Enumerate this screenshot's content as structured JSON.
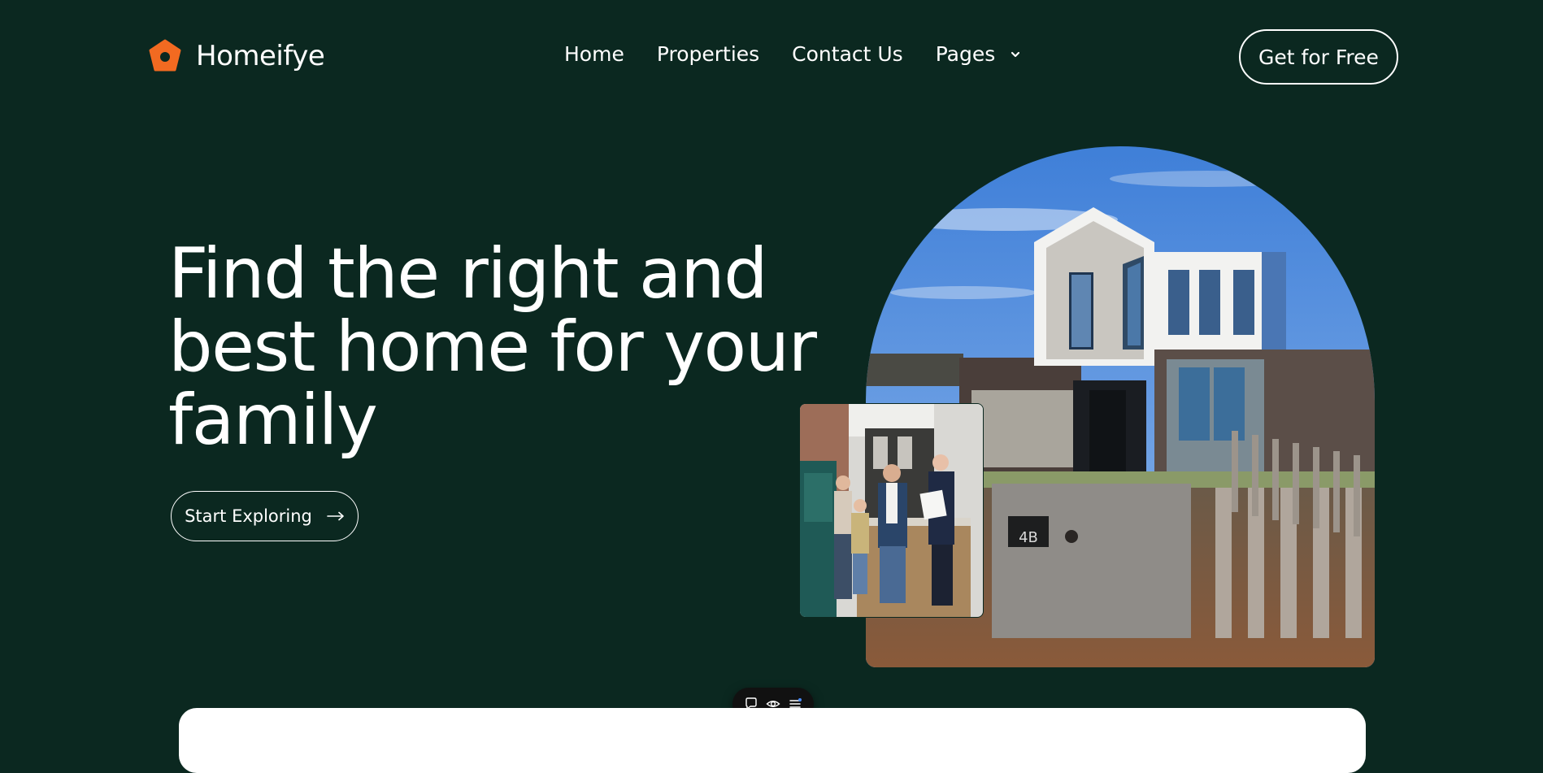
{
  "brand": {
    "name": "Homeifye",
    "logo_color": "#f26a21"
  },
  "nav": {
    "items": [
      {
        "label": "Home"
      },
      {
        "label": "Properties"
      },
      {
        "label": "Contact Us"
      }
    ],
    "pages_label": "Pages",
    "pages_icon": "chevron-down-icon"
  },
  "cta_label": "Get for Free",
  "hero": {
    "title": "Find the right and best home for your family",
    "button_label": "Start Exploring",
    "button_icon": "arrow-right-icon",
    "house_number": "4B"
  },
  "toolbar": {
    "icons": [
      "comment-icon",
      "eye-icon",
      "menu-icon"
    ]
  },
  "colors": {
    "background": "#0b2820",
    "accent": "#f26a21",
    "text": "#ffffff"
  }
}
